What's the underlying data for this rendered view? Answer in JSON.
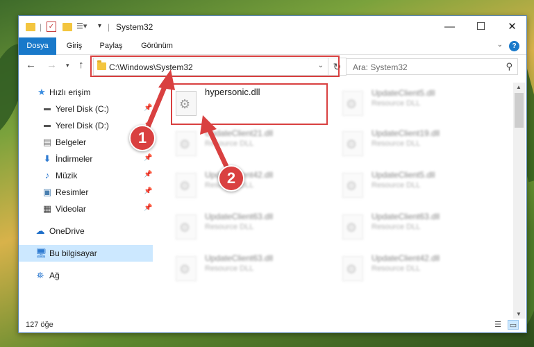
{
  "window": {
    "title": "System32"
  },
  "ribbon": {
    "tabs": [
      {
        "label": "Dosya",
        "active": true
      },
      {
        "label": "Giriş",
        "active": false
      },
      {
        "label": "Paylaş",
        "active": false
      },
      {
        "label": "Görünüm",
        "active": false
      }
    ],
    "help": "?"
  },
  "address": {
    "path": "C:\\Windows\\System32",
    "search_placeholder": "Ara: System32"
  },
  "sidebar": {
    "items": [
      {
        "label": "Hızlı erişim",
        "icon": "star-icon",
        "pinned": false,
        "selected": false
      },
      {
        "label": "Yerel Disk (C:)",
        "icon": "drive-c-icon",
        "pinned": true,
        "selected": false
      },
      {
        "label": "Yerel Disk (D:)",
        "icon": "drive-d-icon",
        "pinned": true,
        "selected": false
      },
      {
        "label": "Belgeler",
        "icon": "documents-icon",
        "pinned": true,
        "selected": false
      },
      {
        "label": "İndirmeler",
        "icon": "download-icon",
        "pinned": true,
        "selected": false
      },
      {
        "label": "Müzik",
        "icon": "music-icon",
        "pinned": true,
        "selected": false
      },
      {
        "label": "Resimler",
        "icon": "pictures-icon",
        "pinned": true,
        "selected": false
      },
      {
        "label": "Videolar",
        "icon": "videos-icon",
        "pinned": true,
        "selected": false
      },
      {
        "label": "OneDrive",
        "icon": "onedrive-icon",
        "pinned": false,
        "selected": false
      },
      {
        "label": "Bu bilgisayar",
        "icon": "computer-icon",
        "pinned": false,
        "selected": true
      },
      {
        "label": "Ağ",
        "icon": "network-icon",
        "pinned": false,
        "selected": false
      }
    ]
  },
  "files": [
    {
      "name": "hypersonic.dll",
      "type": "",
      "highlighted": true
    },
    {
      "name": "UpdateClient5.dll",
      "type": "Resource DLL",
      "highlighted": false
    },
    {
      "name": "UpdateClient21.dll",
      "type": "Resource DLL",
      "highlighted": false
    },
    {
      "name": "UpdateClient19.dll",
      "type": "Resource DLL",
      "highlighted": false
    },
    {
      "name": "UpdateClient42.dll",
      "type": "Resource DLL",
      "highlighted": false
    },
    {
      "name": "UpdateClient5.dll",
      "type": "Resource DLL",
      "highlighted": false
    },
    {
      "name": "UpdateClient63.dll",
      "type": "Resource DLL",
      "highlighted": false
    },
    {
      "name": "UpdateClient63.dll",
      "type": "Resource DLL",
      "highlighted": false
    },
    {
      "name": "UpdateClient63.dll",
      "type": "Resource DLL",
      "highlighted": false
    },
    {
      "name": "UpdateClient42.dll",
      "type": "Resource DLL",
      "highlighted": false
    }
  ],
  "status": {
    "item_count": "127 öğe"
  },
  "annotations": {
    "step1": "1",
    "step2": "2",
    "color": "#d94040"
  }
}
